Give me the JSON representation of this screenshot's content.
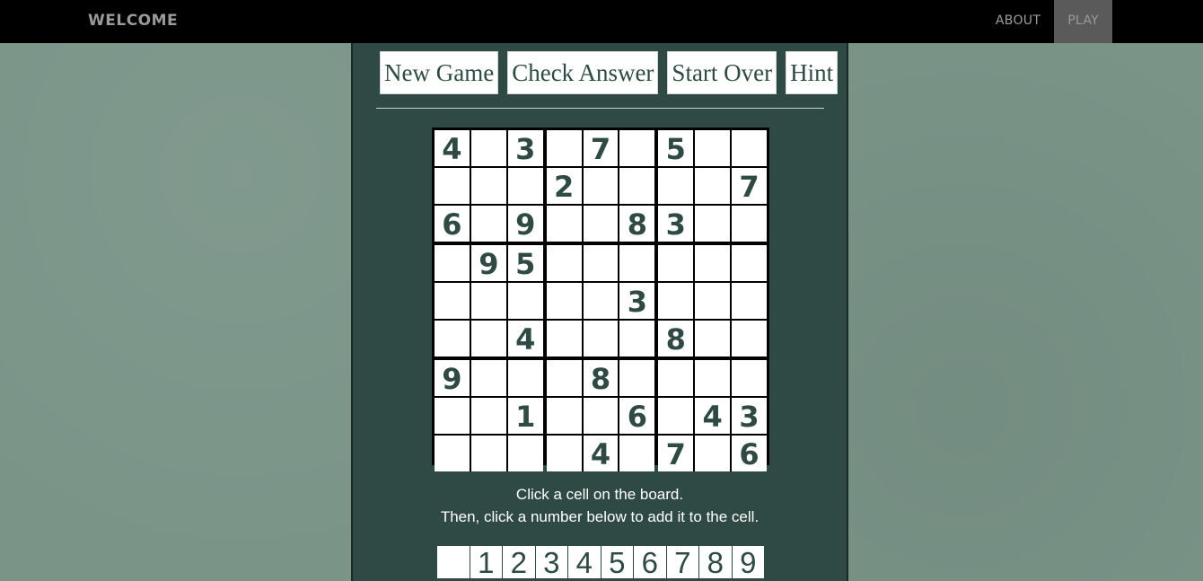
{
  "nav": {
    "brand": "WELCOME",
    "links": [
      {
        "label": "ABOUT",
        "active": false
      },
      {
        "label": "PLAY",
        "active": true
      }
    ]
  },
  "toolbar": {
    "new_game": "New Game",
    "check_answer": "Check Answer",
    "start_over": "Start Over",
    "hint": "Hint"
  },
  "board": {
    "rows": [
      [
        "4",
        "",
        "3",
        "",
        "7",
        "",
        "5",
        "",
        ""
      ],
      [
        "",
        "",
        "",
        "2",
        "",
        "",
        "",
        "",
        "7"
      ],
      [
        "6",
        "",
        "9",
        "",
        "",
        "8",
        "3",
        "",
        ""
      ],
      [
        "",
        "9",
        "5",
        "",
        "",
        "",
        "",
        "",
        ""
      ],
      [
        "",
        "",
        "",
        "",
        "",
        "3",
        "",
        "",
        ""
      ],
      [
        "",
        "",
        "4",
        "",
        "",
        "",
        "8",
        "",
        ""
      ],
      [
        "9",
        "",
        "",
        "",
        "8",
        "",
        "",
        "",
        ""
      ],
      [
        "",
        "",
        "1",
        "",
        "",
        "6",
        "",
        "4",
        "3"
      ],
      [
        "",
        "",
        "",
        "",
        "4",
        "",
        "7",
        "",
        "6"
      ]
    ]
  },
  "instructions": {
    "line1": "Click a cell on the board.",
    "line2": "Then, click a number below to add it to the cell."
  },
  "numpad": [
    "",
    "1",
    "2",
    "3",
    "4",
    "5",
    "6",
    "7",
    "8",
    "9"
  ],
  "colors": {
    "panel": "#2f4a44",
    "background": "#7a9488",
    "digit": "#2f4a44",
    "navbar": "#000000",
    "nav_active": "#5a5a5a"
  }
}
